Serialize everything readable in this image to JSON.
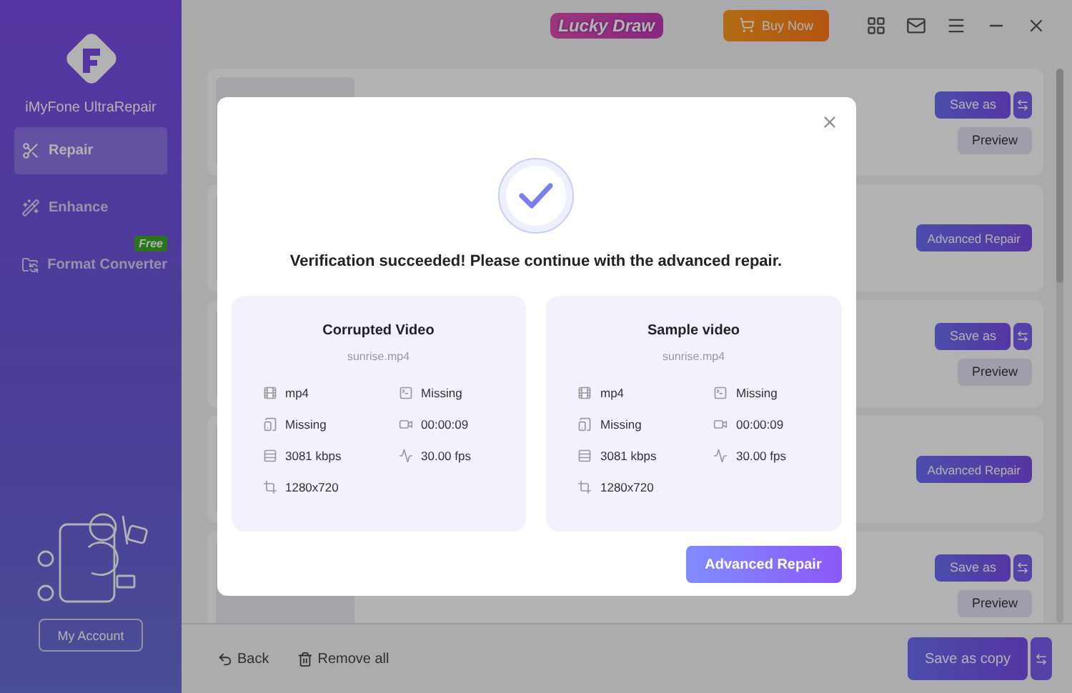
{
  "app": {
    "name": "iMyFone UltraRepair"
  },
  "nav": [
    {
      "label": "Repair",
      "selected": true
    },
    {
      "label": "Enhance",
      "selected": false
    },
    {
      "label": "Format Converter",
      "selected": false,
      "badge": "Free"
    }
  ],
  "account_button": "My Account",
  "topbar": {
    "promo": "Lucky Draw",
    "buy": "Buy Now"
  },
  "files": [
    {
      "kind": "saved",
      "save": "Save as",
      "preview": "Preview"
    },
    {
      "kind": "advanced",
      "action": "Advanced Repair"
    },
    {
      "kind": "saved",
      "save": "Save as",
      "preview": "Preview"
    },
    {
      "kind": "advanced",
      "action": "Advanced Repair"
    },
    {
      "kind": "saved",
      "save": "Save as",
      "preview": "Preview"
    }
  ],
  "footer": {
    "back": "Back",
    "remove": "Remove all",
    "save_copy": "Save as copy"
  },
  "dialog": {
    "message": "Verification succeeded! Please continue with the advanced repair.",
    "panels": [
      {
        "title": "Corrupted Video",
        "file": "sunrise.mp4",
        "specs": [
          {
            "kind": "format",
            "value": "mp4"
          },
          {
            "kind": "codec",
            "value": "Missing"
          },
          {
            "kind": "size",
            "value": "Missing"
          },
          {
            "kind": "duration",
            "value": "00:00:09"
          },
          {
            "kind": "bitrate",
            "value": "3081 kbps"
          },
          {
            "kind": "framerate",
            "value": "30.00 fps"
          },
          {
            "kind": "resolution",
            "value": "1280x720"
          }
        ]
      },
      {
        "title": "Sample video",
        "file": "sunrise.mp4",
        "specs": [
          {
            "kind": "format",
            "value": "mp4"
          },
          {
            "kind": "codec",
            "value": "Missing"
          },
          {
            "kind": "size",
            "value": "Missing"
          },
          {
            "kind": "duration",
            "value": "00:00:09"
          },
          {
            "kind": "bitrate",
            "value": "3081 kbps"
          },
          {
            "kind": "framerate",
            "value": "30.00 fps"
          },
          {
            "kind": "resolution",
            "value": "1280x720"
          }
        ]
      }
    ],
    "button": "Advanced Repair"
  }
}
